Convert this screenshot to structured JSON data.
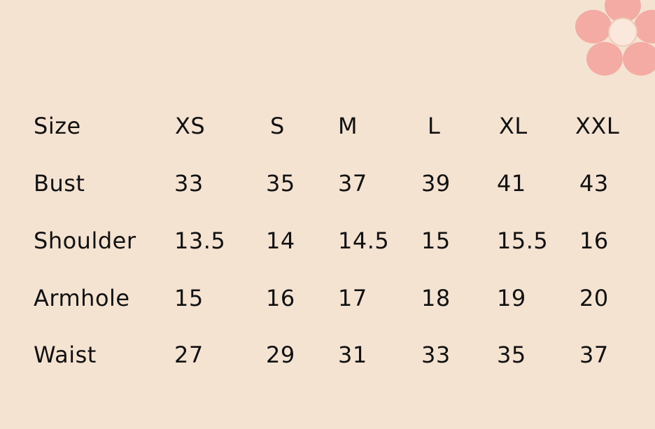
{
  "colors": {
    "background": "#f5e3d2",
    "text": "#111111",
    "flower_petal": "#f3a6a0",
    "flower_center": "#fbe8dc"
  },
  "decoration": {
    "icon": "flower-icon"
  },
  "size_chart": {
    "header": {
      "label": "Size",
      "sizes": [
        "XS",
        "S",
        "M",
        "L",
        "XL",
        "XXL"
      ]
    },
    "rows": [
      {
        "label": "Bust",
        "values": [
          "33",
          "35",
          "37",
          "39",
          "41",
          "43"
        ]
      },
      {
        "label": "Shoulder",
        "values": [
          "13.5",
          "14",
          "14.5",
          "15",
          "15.5",
          "16"
        ]
      },
      {
        "label": "Armhole",
        "values": [
          "15",
          "16",
          "17",
          "18",
          "19",
          "20"
        ]
      },
      {
        "label": "Waist",
        "values": [
          "27",
          "29",
          "31",
          "33",
          "35",
          "37"
        ]
      }
    ]
  }
}
